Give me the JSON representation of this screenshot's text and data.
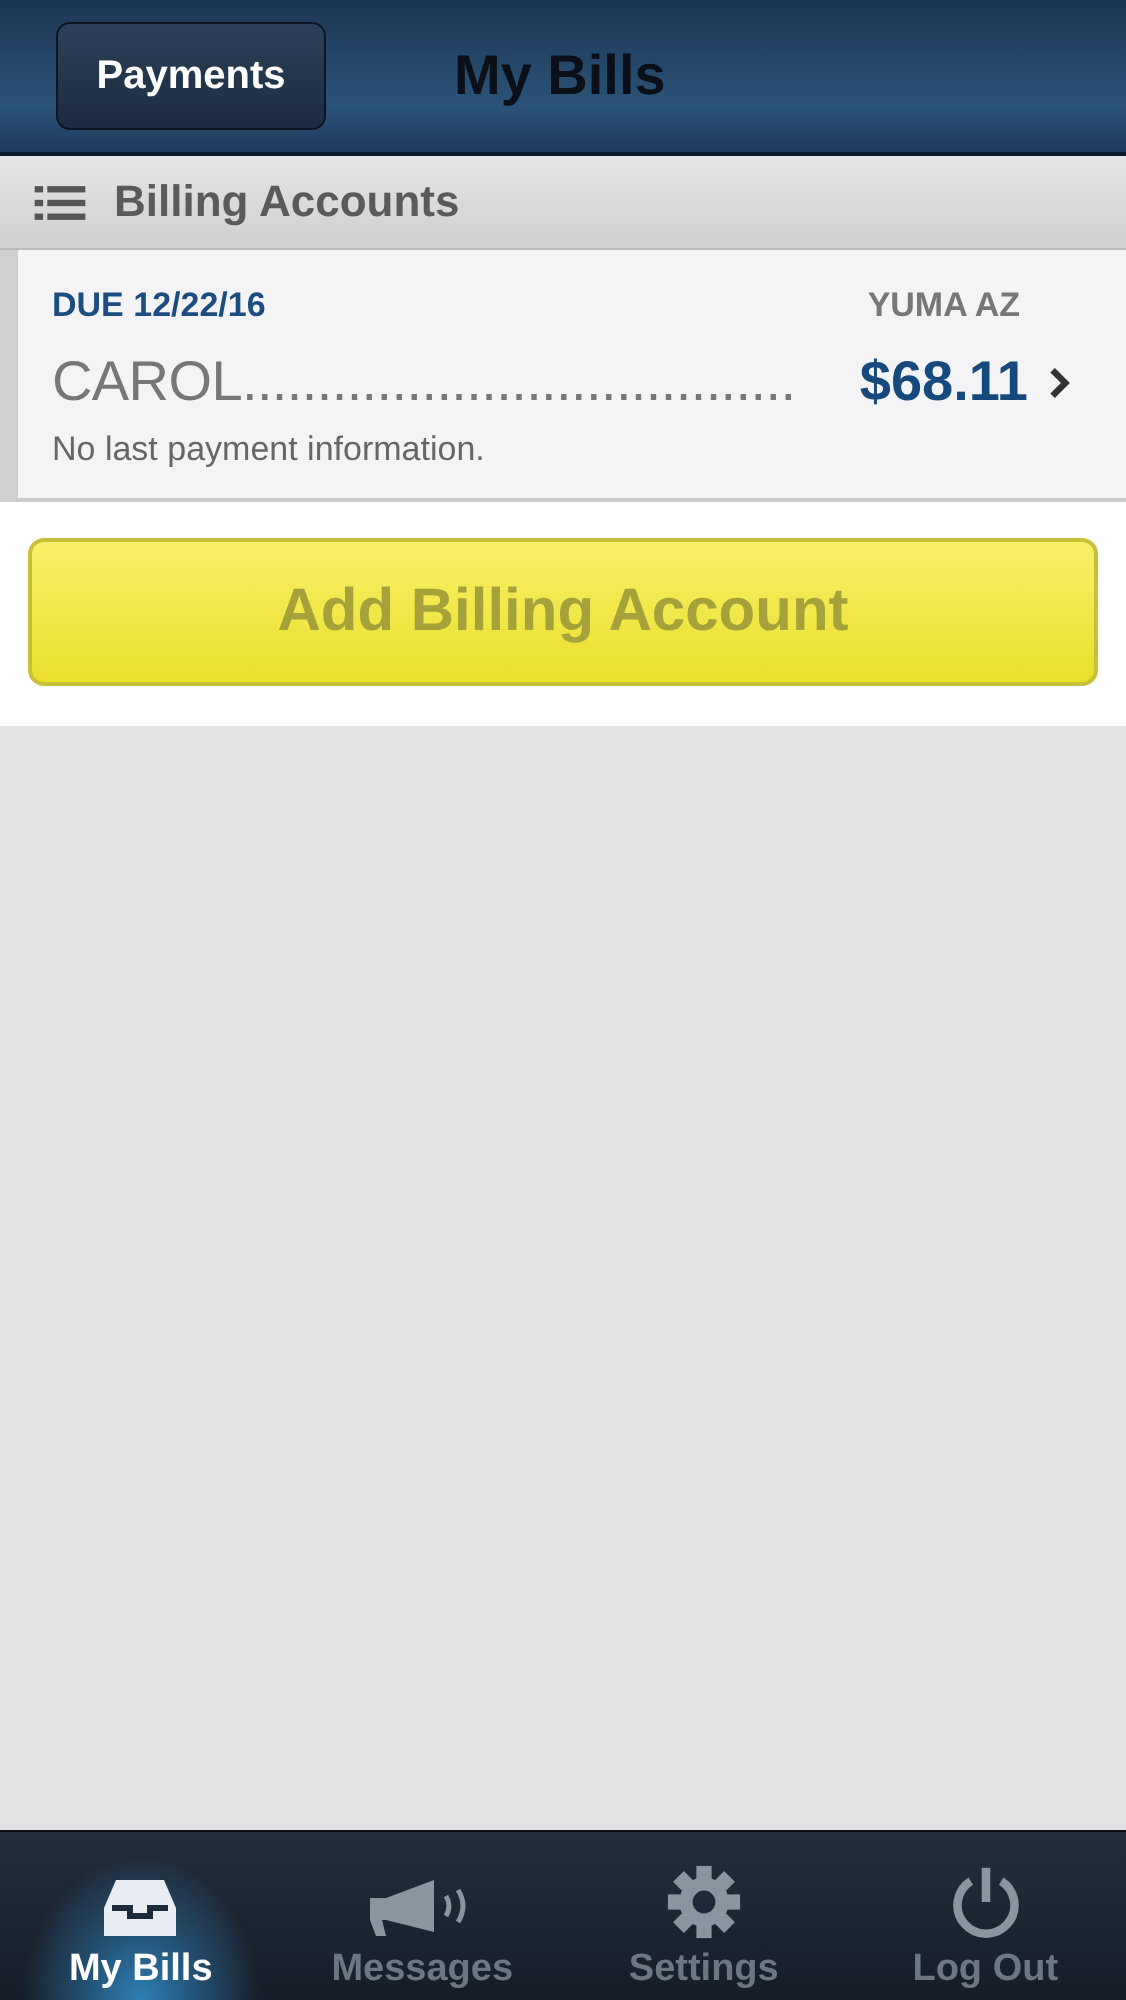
{
  "header": {
    "back_button": "Payments",
    "title": "My Bills"
  },
  "section": {
    "title": "Billing Accounts"
  },
  "accounts": [
    {
      "due": "DUE 12/22/16",
      "location": "YUMA AZ",
      "name": "CAROL.....................................",
      "amount": "$68.11",
      "last_payment": "No last payment information."
    }
  ],
  "add_button": "Add Billing Account",
  "tabs": [
    {
      "label": "My Bills",
      "kind": "inbox",
      "selected": true
    },
    {
      "label": "Messages",
      "kind": "megaphone",
      "selected": false
    },
    {
      "label": "Settings",
      "kind": "gear",
      "selected": false
    },
    {
      "label": "Log Out",
      "kind": "power",
      "selected": false
    }
  ]
}
